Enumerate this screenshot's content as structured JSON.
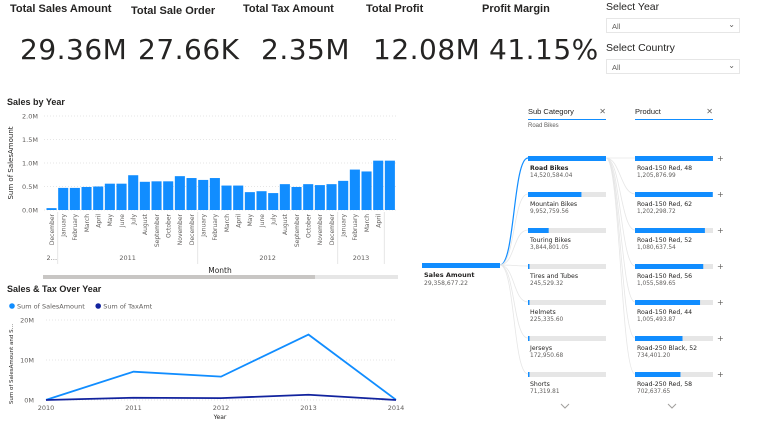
{
  "kpis": [
    {
      "title": "Total Sales Amount",
      "value": "29.36M"
    },
    {
      "title": "Total Sale Order",
      "value": "27.66K"
    },
    {
      "title": "Total Tax Amount",
      "value": "2.35M"
    },
    {
      "title": "Total Profit",
      "value": "12.08M"
    },
    {
      "title": "Profit Margin",
      "value": "41.15%"
    }
  ],
  "slicers": [
    {
      "title": "Select Year",
      "value": "All"
    },
    {
      "title": "Select Country",
      "value": "All"
    }
  ],
  "sales_by_year": {
    "title": "Sales by Year",
    "ylabel": "Sum of SalesAmount",
    "xlabel": "Month",
    "y_ticks": [
      "0.0M",
      "0.5M",
      "1.0M",
      "1.5M",
      "2.0M"
    ],
    "year_labels": [
      "2…",
      "2011",
      "2012",
      "2013"
    ]
  },
  "sales_tax": {
    "title": "Sales & Tax Over Year",
    "legend": [
      "Sum of SalesAmount",
      "Sum of TaxAmt"
    ],
    "ylabel": "Sum of SalesAmount and S…",
    "xlabel": "Year",
    "y_ticks": [
      "0M",
      "10M",
      "20M"
    ]
  },
  "decomp": {
    "sub_category_header": "Sub Category",
    "sub_category_filter": "Road Bikes",
    "product_header": "Product",
    "root": {
      "label": "Sales Amount",
      "value": "29,358,677.22"
    },
    "subcategories": [
      {
        "name": "Road Bikes",
        "value": "14,520,584.04",
        "fill": 1.0
      },
      {
        "name": "Mountain Bikes",
        "value": "9,952,759.56",
        "fill": 0.685
      },
      {
        "name": "Touring Bikes",
        "value": "3,844,801.05",
        "fill": 0.265
      },
      {
        "name": "Tires and Tubes",
        "value": "245,529.32",
        "fill": 0.017
      },
      {
        "name": "Helmets",
        "value": "225,335.60",
        "fill": 0.016
      },
      {
        "name": "Jerseys",
        "value": "172,950.68",
        "fill": 0.012
      },
      {
        "name": "Shorts",
        "value": "71,319.81",
        "fill": 0.005
      }
    ],
    "products": [
      {
        "name": "Road-150 Red, 48",
        "value": "1,205,876.99",
        "fill": 1.0
      },
      {
        "name": "Road-150 Red, 62",
        "value": "1,202,298.72",
        "fill": 0.997
      },
      {
        "name": "Road-150 Red, 52",
        "value": "1,080,637.54",
        "fill": 0.896
      },
      {
        "name": "Road-150 Red, 56",
        "value": "1,055,589.65",
        "fill": 0.875
      },
      {
        "name": "Road-150 Red, 44",
        "value": "1,005,493.87",
        "fill": 0.834
      },
      {
        "name": "Road-250 Black, 52",
        "value": "734,401.20",
        "fill": 0.609
      },
      {
        "name": "Road-250 Red, 58",
        "value": "702,637.65",
        "fill": 0.583
      }
    ]
  },
  "chart_data": [
    {
      "type": "bar",
      "title": "Sales by Year",
      "xlabel": "Month",
      "ylabel": "Sum of SalesAmount",
      "ylim": [
        0,
        2.0
      ],
      "unit": "M",
      "grid": true,
      "categories": [
        "December",
        "January",
        "February",
        "March",
        "April",
        "May",
        "June",
        "July",
        "August",
        "September",
        "October",
        "November",
        "December",
        "January",
        "February",
        "March",
        "April",
        "May",
        "June",
        "July",
        "August",
        "September",
        "October",
        "November",
        "December",
        "January",
        "February",
        "March",
        "April"
      ],
      "values": [
        0.04,
        0.47,
        0.47,
        0.49,
        0.5,
        0.56,
        0.56,
        0.74,
        0.6,
        0.61,
        0.61,
        0.72,
        0.68,
        0.64,
        0.68,
        0.52,
        0.52,
        0.38,
        0.4,
        0.36,
        0.55,
        0.49,
        0.55,
        0.53,
        0.55,
        0.62,
        0.86,
        0.82,
        1.05,
        1.05
      ],
      "year_groups": [
        {
          "label": "2…",
          "start": 0,
          "end": 0
        },
        {
          "label": "2011",
          "start": 1,
          "end": 12
        },
        {
          "label": "2012",
          "start": 13,
          "end": 24
        },
        {
          "label": "2013",
          "start": 25,
          "end": 28
        }
      ]
    },
    {
      "type": "line",
      "title": "Sales & Tax Over Year",
      "xlabel": "Year",
      "ylabel": "Sum of SalesAmount and S…",
      "x": [
        2010,
        2011,
        2012,
        2013,
        2014
      ],
      "ylim": [
        0,
        20
      ],
      "unit": "M",
      "series": [
        {
          "name": "Sum of SalesAmount",
          "color": "#118dff",
          "values": [
            0.04,
            7.08,
            5.84,
            16.35,
            0.05
          ]
        },
        {
          "name": "Sum of TaxAmt",
          "color": "#12239e",
          "values": [
            0.003,
            0.57,
            0.47,
            1.31,
            0.004
          ]
        }
      ]
    }
  ]
}
